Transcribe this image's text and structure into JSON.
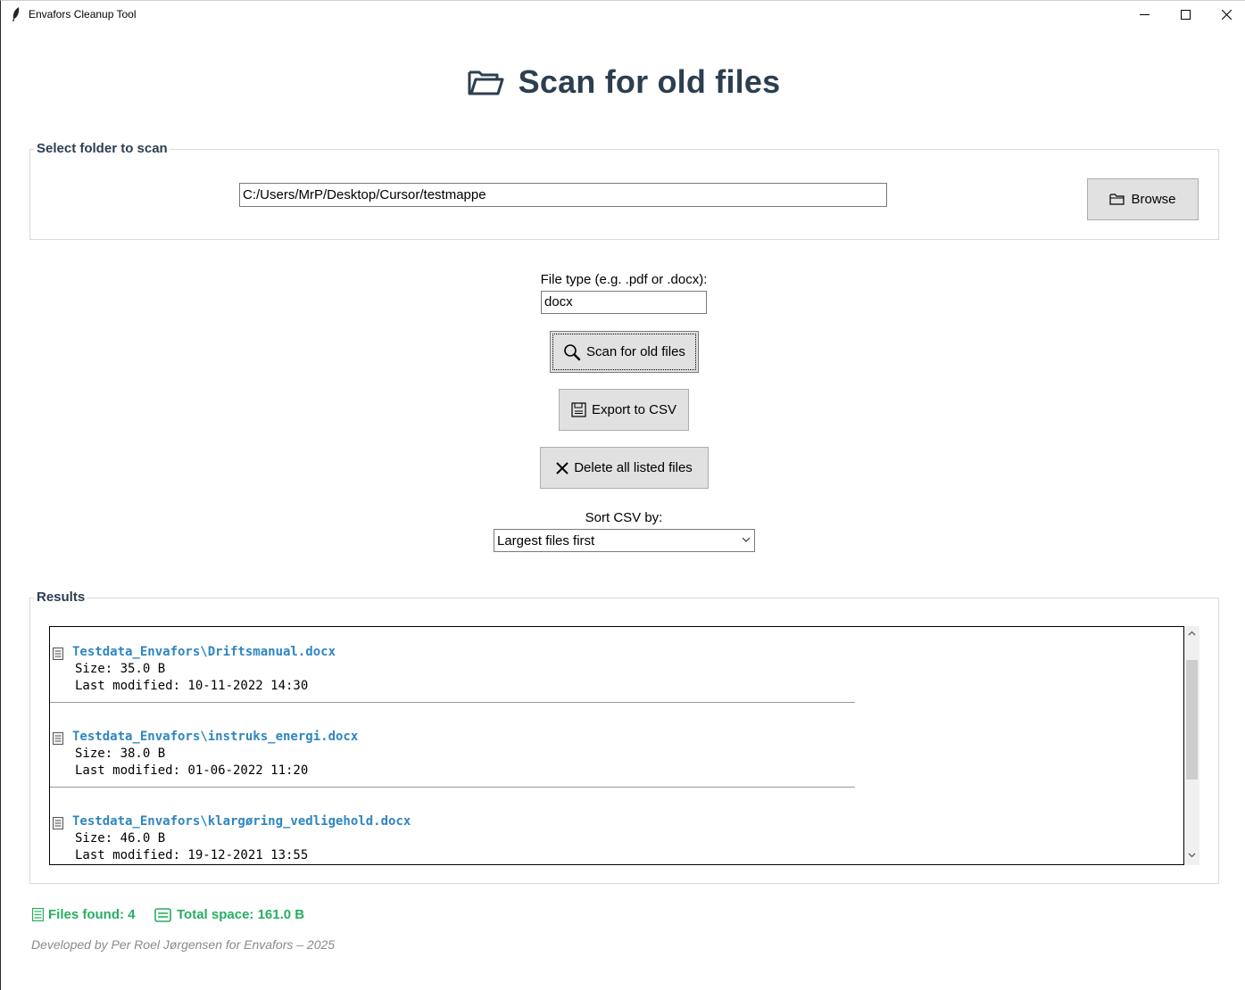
{
  "window": {
    "title": "Envafors Cleanup Tool"
  },
  "header": {
    "title": "Scan for old files",
    "icon": "open-folder-icon"
  },
  "folder_frame": {
    "label": "Select folder to scan",
    "path_value": "C:/Users/MrP/Desktop/Cursor/testmappe",
    "browse_label": "Browse"
  },
  "controls": {
    "file_type_label": "File type (e.g. .pdf or .docx):",
    "file_type_value": "docx",
    "scan_label": "Scan for old files",
    "export_label": "Export to CSV",
    "delete_label": "Delete all listed files",
    "sort_label": "Sort CSV by:",
    "sort_selected": "Largest files first"
  },
  "results": {
    "label": "Results",
    "items": [
      {
        "name": "Testdata_Envafors\\Driftsmanual.docx",
        "size": "Size: 35.0 B",
        "modified": "Last modified: 10-11-2022 14:30"
      },
      {
        "name": "Testdata_Envafors\\instruks_energi.docx",
        "size": "Size: 38.0 B",
        "modified": "Last modified: 01-06-2022 11:20"
      },
      {
        "name": "Testdata_Envafors\\klargøring_vedligehold.docx",
        "size": "Size: 46.0 B",
        "modified": "Last modified: 19-12-2021 13:55"
      }
    ]
  },
  "status": {
    "files_found": "Files found: 4",
    "total_space": "Total space: 161.0 B"
  },
  "footer": {
    "credit": "Developed by Per Roel Jørgensen for Envafors – 2025"
  },
  "colors": {
    "heading": "#2c3e50",
    "filename": "#2e86c1",
    "status": "#27ae60",
    "footer": "#8a8a8a"
  }
}
